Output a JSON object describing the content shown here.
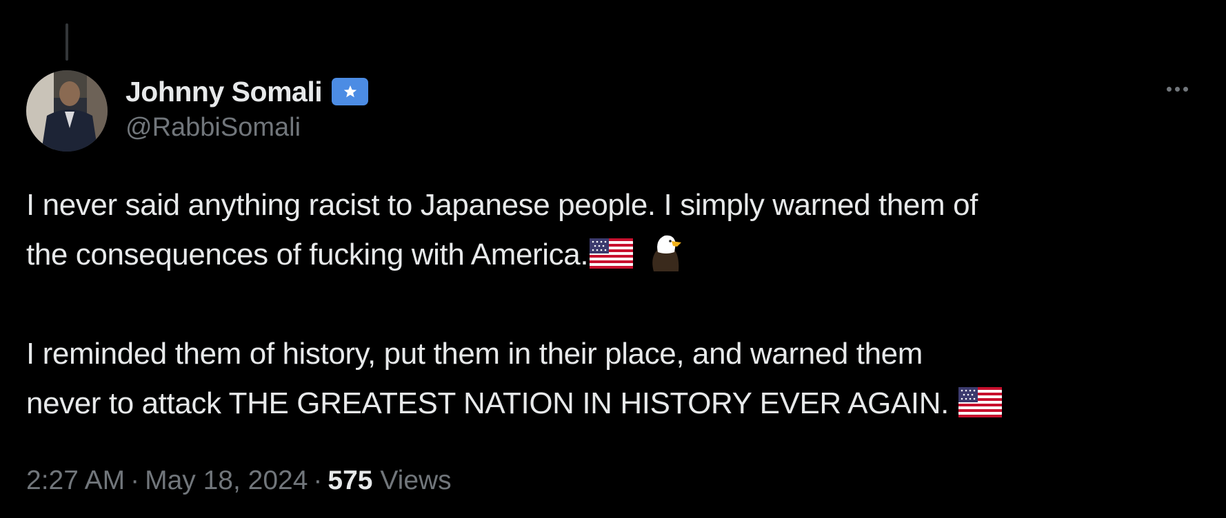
{
  "tweet": {
    "author": {
      "display_name": "Johnny Somali",
      "handle": "@RabbiSomali",
      "verified_badge": "star-flag-badge",
      "badge_color": "#4c8ce4"
    },
    "paragraphs": [
      {
        "lines": [
          "I never said anything racist to Japanese people. I simply warned them of",
          "the consequences of fucking with America."
        ],
        "trailing_emoji": [
          "us-flag-emoji",
          "eagle-emoji"
        ]
      },
      {
        "lines": [
          "I reminded them of history, put them in their place, and warned them",
          "never to attack THE GREATEST NATION IN HISTORY EVER AGAIN. "
        ],
        "trailing_emoji": [
          "us-flag-emoji"
        ]
      }
    ],
    "meta": {
      "time": "2:27 AM",
      "separator": "·",
      "date": "May 18, 2024",
      "views_count": "575",
      "views_label": "Views"
    }
  },
  "colors": {
    "background": "#000000",
    "text_primary": "#e7e9ea",
    "text_secondary": "#71767b"
  }
}
